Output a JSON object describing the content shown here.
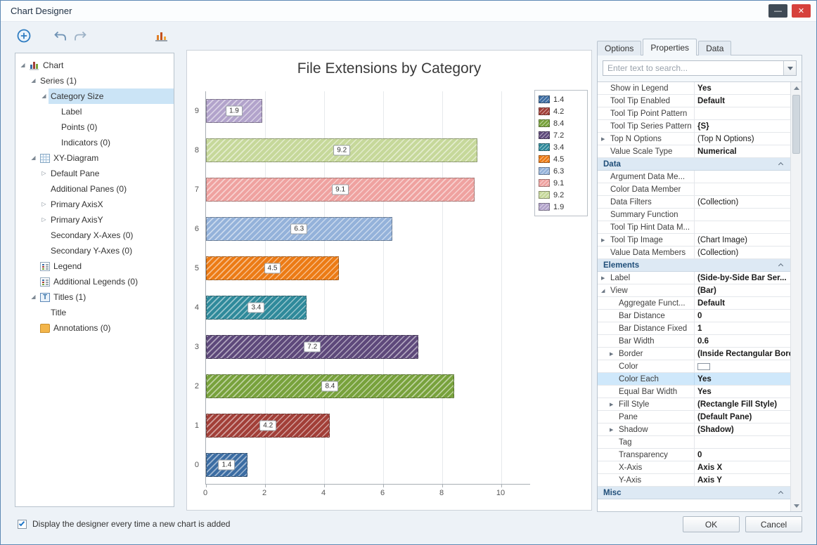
{
  "window": {
    "title": "Chart Designer",
    "minimize_glyph": "—",
    "close_glyph": "✕"
  },
  "tree": {
    "items": [
      {
        "label": "Chart",
        "level": 0,
        "expander": "expanded",
        "icon": "bar-chart"
      },
      {
        "label": "Series (1)",
        "level": 1,
        "expander": "expanded"
      },
      {
        "label": "Category Size",
        "level": 2,
        "expander": "expanded",
        "selected": true
      },
      {
        "label": "Label",
        "level": 3
      },
      {
        "label": "Points (0)",
        "level": 3
      },
      {
        "label": "Indicators (0)",
        "level": 3
      },
      {
        "label": "XY-Diagram",
        "level": 1,
        "expander": "expanded",
        "icon": "grid"
      },
      {
        "label": "Default Pane",
        "level": 2,
        "expander": "collapsed"
      },
      {
        "label": "Additional Panes (0)",
        "level": 2
      },
      {
        "label": "Primary AxisX",
        "level": 2,
        "expander": "collapsed"
      },
      {
        "label": "Primary AxisY",
        "level": 2,
        "expander": "collapsed"
      },
      {
        "label": "Secondary X-Axes (0)",
        "level": 2
      },
      {
        "label": "Secondary Y-Axes (0)",
        "level": 2
      },
      {
        "label": "Legend",
        "level": 1,
        "icon": "legend"
      },
      {
        "label": "Additional Legends (0)",
        "level": 1,
        "icon": "legend"
      },
      {
        "label": "Titles (1)",
        "level": 1,
        "expander": "expanded",
        "icon": "title"
      },
      {
        "label": "Title",
        "level": 2
      },
      {
        "label": "Annotations (0)",
        "level": 1,
        "icon": "annotation"
      }
    ]
  },
  "chart_data": {
    "type": "bar",
    "orientation": "horizontal",
    "title": "File Extensions by Category",
    "categories": [
      "0",
      "1",
      "2",
      "3",
      "4",
      "5",
      "6",
      "7",
      "8",
      "9"
    ],
    "values": [
      1.4,
      4.2,
      8.4,
      7.2,
      3.4,
      4.5,
      6.3,
      9.1,
      9.2,
      1.9
    ],
    "value_labels": [
      "1.4",
      "4.2",
      "8.4",
      "7.2",
      "3.4",
      "4.5",
      "6.3",
      "9.1",
      "9.2",
      "1.9"
    ],
    "bar_colors": [
      "#3c6da3",
      "#a23f38",
      "#78a23c",
      "#5e497b",
      "#2f8a9b",
      "#ec7b15",
      "#94b2da",
      "#efa2a0",
      "#c6d89a",
      "#b2a3cb"
    ],
    "xlim": [
      0,
      11
    ],
    "x_ticks": [
      0,
      2,
      4,
      6,
      8,
      10
    ],
    "grid": "vertical-gridlines",
    "legend": {
      "position": "top-right",
      "entries": [
        {
          "label": "1.4",
          "color": "#3c6da3"
        },
        {
          "label": "4.2",
          "color": "#a23f38"
        },
        {
          "label": "8.4",
          "color": "#78a23c"
        },
        {
          "label": "7.2",
          "color": "#5e497b"
        },
        {
          "label": "3.4",
          "color": "#2f8a9b"
        },
        {
          "label": "4.5",
          "color": "#ec7b15"
        },
        {
          "label": "6.3",
          "color": "#94b2da"
        },
        {
          "label": "9.1",
          "color": "#efa2a0"
        },
        {
          "label": "9.2",
          "color": "#c6d89a"
        },
        {
          "label": "1.9",
          "color": "#b2a3cb"
        }
      ]
    }
  },
  "properties_panel": {
    "tabs": [
      {
        "label": "Options",
        "active": false
      },
      {
        "label": "Properties",
        "active": true
      },
      {
        "label": "Data",
        "active": false
      }
    ],
    "search": {
      "placeholder": "Enter text to search..."
    },
    "rows": [
      {
        "name": "Show in Legend",
        "value": "Yes",
        "bold": true
      },
      {
        "name": "Tool Tip Enabled",
        "value": "Default",
        "bold": true
      },
      {
        "name": "Tool Tip Point Pattern",
        "value": ""
      },
      {
        "name": "Tool Tip Series Pattern",
        "value": "{S}",
        "bold": true
      },
      {
        "name": "Top N Options",
        "value": "(Top N Options)",
        "expander": "collapsed"
      },
      {
        "name": "Value Scale Type",
        "value": "Numerical",
        "bold": true
      },
      {
        "type": "category",
        "name": "Data"
      },
      {
        "name": "Argument Data Me...",
        "value": ""
      },
      {
        "name": "Color Data Member",
        "value": ""
      },
      {
        "name": "Data Filters",
        "value": "(Collection)"
      },
      {
        "name": "Summary Function",
        "value": ""
      },
      {
        "name": "Tool Tip Hint Data M...",
        "value": ""
      },
      {
        "name": "Tool Tip Image",
        "value": "(Chart Image)",
        "expander": "collapsed"
      },
      {
        "name": "Value Data Members",
        "value": "(Collection)"
      },
      {
        "type": "category",
        "name": "Elements"
      },
      {
        "name": "Label",
        "value": "(Side-by-Side Bar Ser...",
        "bold": true,
        "expander": "collapsed"
      },
      {
        "name": "View",
        "value": "(Bar)",
        "bold": true,
        "expander": "expanded"
      },
      {
        "name": "Aggregate Funct...",
        "value": "Default",
        "bold": true,
        "indent": 1
      },
      {
        "name": "Bar Distance",
        "value": "0",
        "bold": true,
        "indent": 1
      },
      {
        "name": "Bar Distance Fixed",
        "value": "1",
        "bold": true,
        "indent": 1
      },
      {
        "name": "Bar Width",
        "value": "0.6",
        "bold": true,
        "indent": 1
      },
      {
        "name": "Border",
        "value": "(Inside Rectangular Bord...",
        "bold": true,
        "indent": 1,
        "expander": "collapsed"
      },
      {
        "name": "Color",
        "value": "",
        "indent": 1,
        "swatch": true
      },
      {
        "name": "Color Each",
        "value": "Yes",
        "bold": true,
        "indent": 1,
        "selected": true
      },
      {
        "name": "Equal Bar Width",
        "value": "Yes",
        "bold": true,
        "indent": 1
      },
      {
        "name": "Fill Style",
        "value": "(Rectangle Fill Style)",
        "bold": true,
        "indent": 1,
        "expander": "collapsed"
      },
      {
        "name": "Pane",
        "value": "(Default Pane)",
        "bold": true,
        "indent": 1
      },
      {
        "name": "Shadow",
        "value": "(Shadow)",
        "bold": true,
        "indent": 1,
        "expander": "collapsed"
      },
      {
        "name": "Tag",
        "value": "",
        "indent": 1
      },
      {
        "name": "Transparency",
        "value": "0",
        "bold": true,
        "indent": 1
      },
      {
        "name": "X-Axis",
        "value": "Axis X",
        "bold": true,
        "indent": 1
      },
      {
        "name": "Y-Axis",
        "value": "Axis Y",
        "bold": true,
        "indent": 1
      },
      {
        "type": "category",
        "name": "Misc"
      }
    ]
  },
  "footer": {
    "checkbox_label": "Display the designer every time a new chart is added",
    "checkbox_checked": true,
    "ok_label": "OK",
    "cancel_label": "Cancel"
  }
}
